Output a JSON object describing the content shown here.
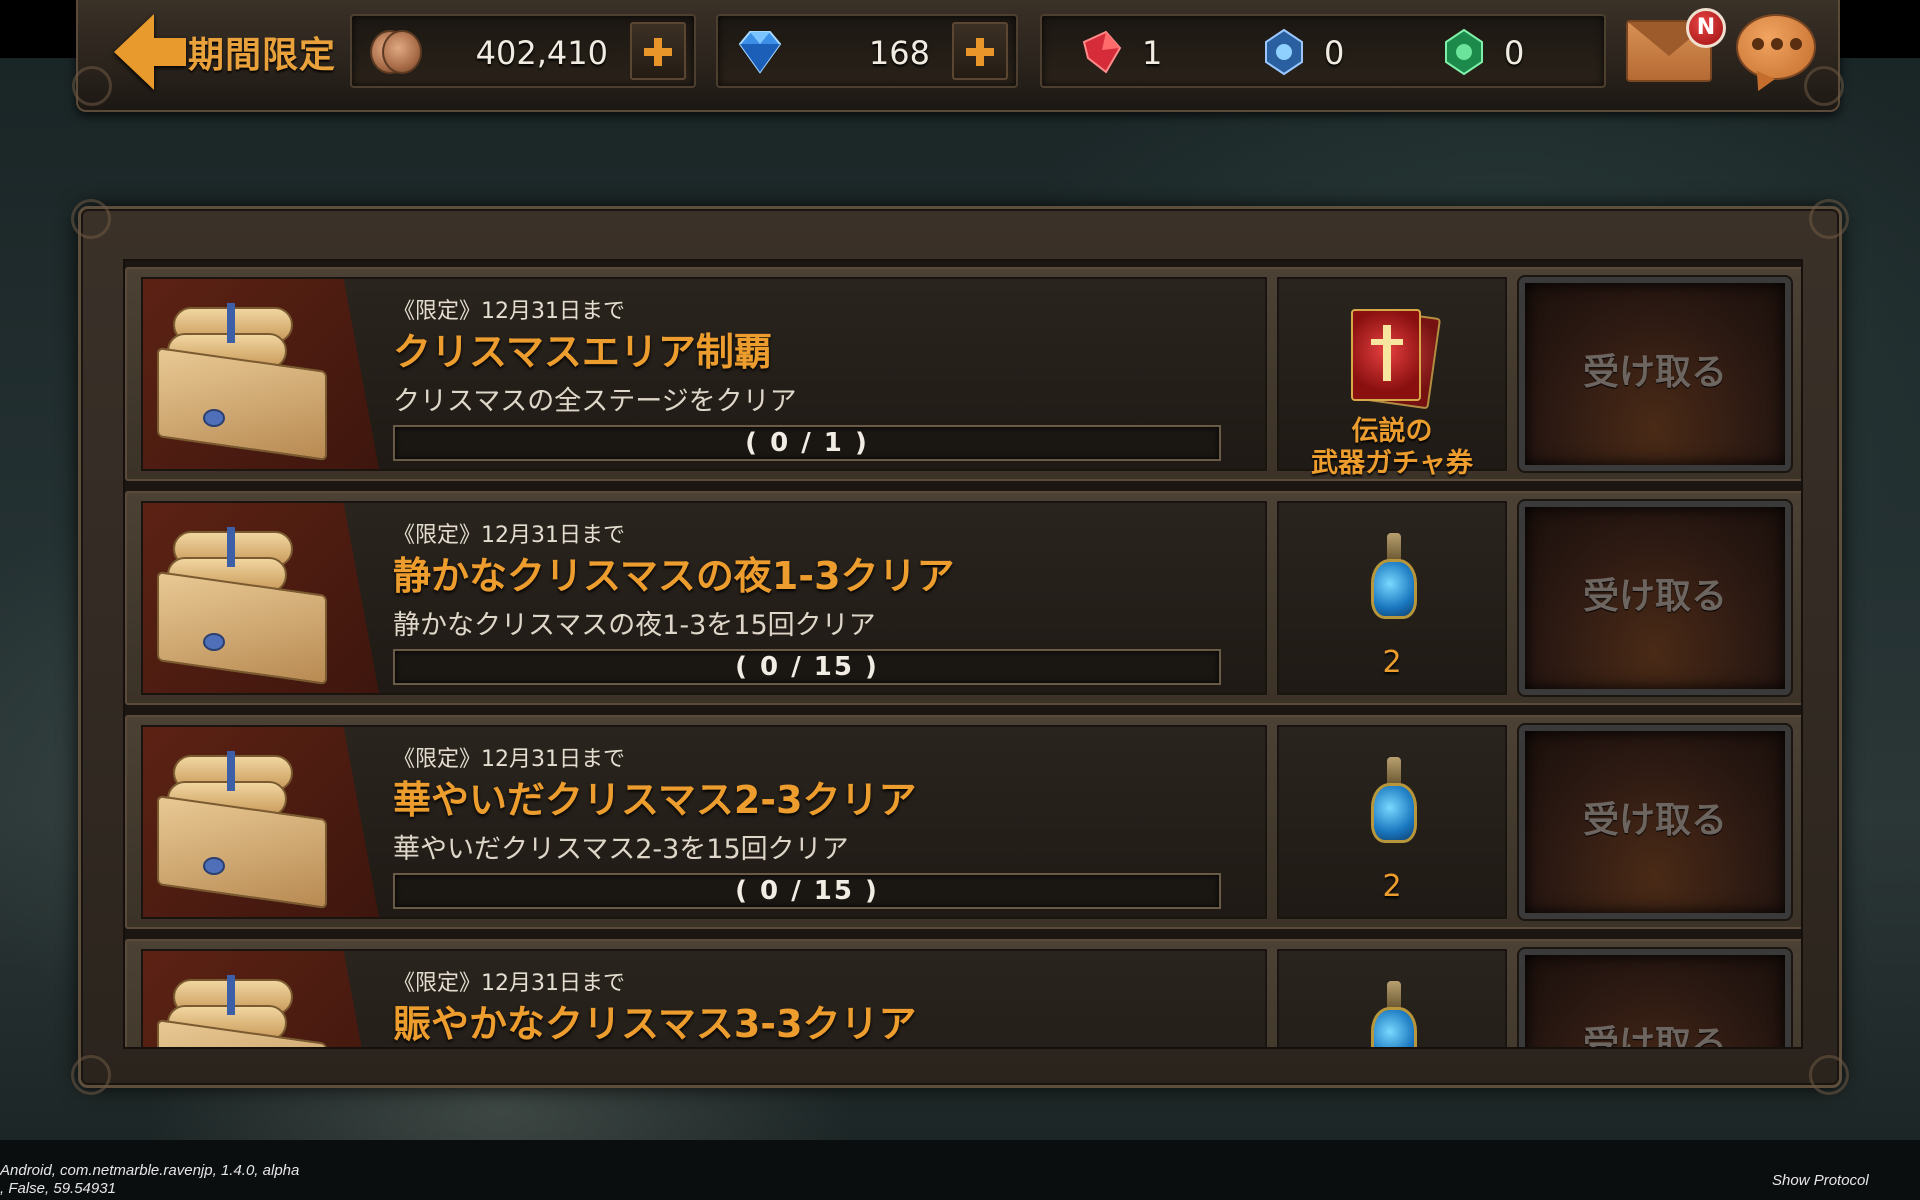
{
  "header": {
    "title": "期間限定",
    "coins": "402,410",
    "gems": "168",
    "red_crystal": "1",
    "blue_crystal": "0",
    "green_crystal": "0",
    "mail_badge": "N"
  },
  "quests": [
    {
      "deadline": "《限定》12月31日まで",
      "title": "クリスマスエリア制覇",
      "description": "クリスマスの全ステージをクリア",
      "progress_text": "( 0 / 1 )",
      "progress_fraction": 0,
      "reward_type": "ticket",
      "reward_label_line1": "伝説の",
      "reward_label_line2": "武器ガチャ券",
      "claim_label": "受け取る"
    },
    {
      "deadline": "《限定》12月31日まで",
      "title": "静かなクリスマスの夜1-3クリア",
      "description": "静かなクリスマスの夜1-3を15回クリア",
      "progress_text": "( 0 / 15 )",
      "progress_fraction": 0,
      "reward_type": "potion",
      "reward_count": "2",
      "claim_label": "受け取る"
    },
    {
      "deadline": "《限定》12月31日まで",
      "title": "華やいだクリスマス2-3クリア",
      "description": "華やいだクリスマス2-3を15回クリア",
      "progress_text": "( 0 / 15 )",
      "progress_fraction": 0,
      "reward_type": "potion",
      "reward_count": "2",
      "claim_label": "受け取る"
    },
    {
      "deadline": "《限定》12月31日まで",
      "title": "賑やかなクリスマス3-3クリア",
      "claim_label": "受け取る"
    }
  ],
  "debug": {
    "line1": "Android, com.netmarble.ravenjp, 1.4.0, alpha",
    "line2": ", False, 59.54931",
    "show_protocol": "Show Protocol"
  }
}
